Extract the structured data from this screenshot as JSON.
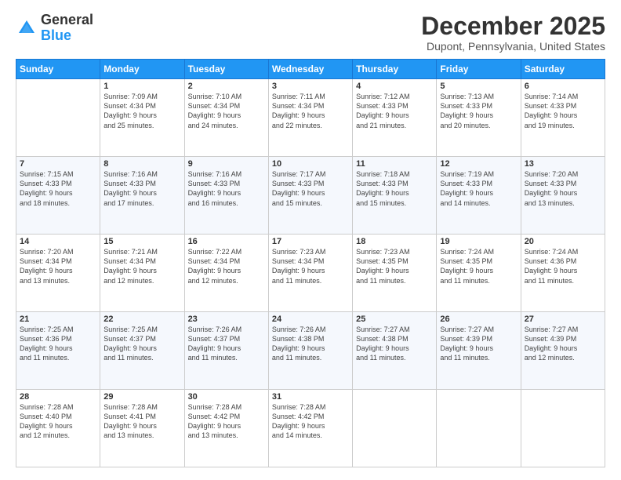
{
  "header": {
    "logo_general": "General",
    "logo_blue": "Blue",
    "month_title": "December 2025",
    "location": "Dupont, Pennsylvania, United States"
  },
  "weekdays": [
    "Sunday",
    "Monday",
    "Tuesday",
    "Wednesday",
    "Thursday",
    "Friday",
    "Saturday"
  ],
  "weeks": [
    [
      {
        "day": "",
        "info": ""
      },
      {
        "day": "1",
        "info": "Sunrise: 7:09 AM\nSunset: 4:34 PM\nDaylight: 9 hours\nand 25 minutes."
      },
      {
        "day": "2",
        "info": "Sunrise: 7:10 AM\nSunset: 4:34 PM\nDaylight: 9 hours\nand 24 minutes."
      },
      {
        "day": "3",
        "info": "Sunrise: 7:11 AM\nSunset: 4:34 PM\nDaylight: 9 hours\nand 22 minutes."
      },
      {
        "day": "4",
        "info": "Sunrise: 7:12 AM\nSunset: 4:33 PM\nDaylight: 9 hours\nand 21 minutes."
      },
      {
        "day": "5",
        "info": "Sunrise: 7:13 AM\nSunset: 4:33 PM\nDaylight: 9 hours\nand 20 minutes."
      },
      {
        "day": "6",
        "info": "Sunrise: 7:14 AM\nSunset: 4:33 PM\nDaylight: 9 hours\nand 19 minutes."
      }
    ],
    [
      {
        "day": "7",
        "info": "Sunrise: 7:15 AM\nSunset: 4:33 PM\nDaylight: 9 hours\nand 18 minutes."
      },
      {
        "day": "8",
        "info": "Sunrise: 7:16 AM\nSunset: 4:33 PM\nDaylight: 9 hours\nand 17 minutes."
      },
      {
        "day": "9",
        "info": "Sunrise: 7:16 AM\nSunset: 4:33 PM\nDaylight: 9 hours\nand 16 minutes."
      },
      {
        "day": "10",
        "info": "Sunrise: 7:17 AM\nSunset: 4:33 PM\nDaylight: 9 hours\nand 15 minutes."
      },
      {
        "day": "11",
        "info": "Sunrise: 7:18 AM\nSunset: 4:33 PM\nDaylight: 9 hours\nand 15 minutes."
      },
      {
        "day": "12",
        "info": "Sunrise: 7:19 AM\nSunset: 4:33 PM\nDaylight: 9 hours\nand 14 minutes."
      },
      {
        "day": "13",
        "info": "Sunrise: 7:20 AM\nSunset: 4:33 PM\nDaylight: 9 hours\nand 13 minutes."
      }
    ],
    [
      {
        "day": "14",
        "info": "Sunrise: 7:20 AM\nSunset: 4:34 PM\nDaylight: 9 hours\nand 13 minutes."
      },
      {
        "day": "15",
        "info": "Sunrise: 7:21 AM\nSunset: 4:34 PM\nDaylight: 9 hours\nand 12 minutes."
      },
      {
        "day": "16",
        "info": "Sunrise: 7:22 AM\nSunset: 4:34 PM\nDaylight: 9 hours\nand 12 minutes."
      },
      {
        "day": "17",
        "info": "Sunrise: 7:23 AM\nSunset: 4:34 PM\nDaylight: 9 hours\nand 11 minutes."
      },
      {
        "day": "18",
        "info": "Sunrise: 7:23 AM\nSunset: 4:35 PM\nDaylight: 9 hours\nand 11 minutes."
      },
      {
        "day": "19",
        "info": "Sunrise: 7:24 AM\nSunset: 4:35 PM\nDaylight: 9 hours\nand 11 minutes."
      },
      {
        "day": "20",
        "info": "Sunrise: 7:24 AM\nSunset: 4:36 PM\nDaylight: 9 hours\nand 11 minutes."
      }
    ],
    [
      {
        "day": "21",
        "info": "Sunrise: 7:25 AM\nSunset: 4:36 PM\nDaylight: 9 hours\nand 11 minutes."
      },
      {
        "day": "22",
        "info": "Sunrise: 7:25 AM\nSunset: 4:37 PM\nDaylight: 9 hours\nand 11 minutes."
      },
      {
        "day": "23",
        "info": "Sunrise: 7:26 AM\nSunset: 4:37 PM\nDaylight: 9 hours\nand 11 minutes."
      },
      {
        "day": "24",
        "info": "Sunrise: 7:26 AM\nSunset: 4:38 PM\nDaylight: 9 hours\nand 11 minutes."
      },
      {
        "day": "25",
        "info": "Sunrise: 7:27 AM\nSunset: 4:38 PM\nDaylight: 9 hours\nand 11 minutes."
      },
      {
        "day": "26",
        "info": "Sunrise: 7:27 AM\nSunset: 4:39 PM\nDaylight: 9 hours\nand 11 minutes."
      },
      {
        "day": "27",
        "info": "Sunrise: 7:27 AM\nSunset: 4:39 PM\nDaylight: 9 hours\nand 12 minutes."
      }
    ],
    [
      {
        "day": "28",
        "info": "Sunrise: 7:28 AM\nSunset: 4:40 PM\nDaylight: 9 hours\nand 12 minutes."
      },
      {
        "day": "29",
        "info": "Sunrise: 7:28 AM\nSunset: 4:41 PM\nDaylight: 9 hours\nand 13 minutes."
      },
      {
        "day": "30",
        "info": "Sunrise: 7:28 AM\nSunset: 4:42 PM\nDaylight: 9 hours\nand 13 minutes."
      },
      {
        "day": "31",
        "info": "Sunrise: 7:28 AM\nSunset: 4:42 PM\nDaylight: 9 hours\nand 14 minutes."
      },
      {
        "day": "",
        "info": ""
      },
      {
        "day": "",
        "info": ""
      },
      {
        "day": "",
        "info": ""
      }
    ]
  ]
}
